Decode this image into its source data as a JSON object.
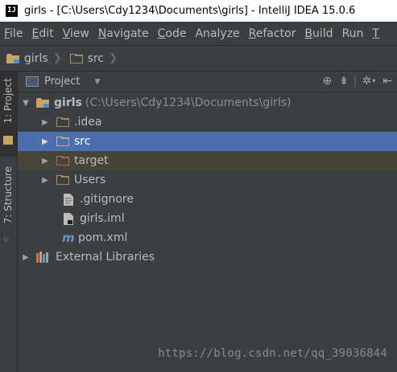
{
  "window": {
    "title": "girls - [C:\\Users\\Cdy1234\\Documents\\girls] - IntelliJ IDEA 15.0.6",
    "app_icon_text": "IJ"
  },
  "menu": [
    {
      "mnemonic": "F",
      "rest": "ile"
    },
    {
      "mnemonic": "E",
      "rest": "dit"
    },
    {
      "mnemonic": "V",
      "rest": "iew"
    },
    {
      "mnemonic": "N",
      "rest": "avigate"
    },
    {
      "mnemonic": "C",
      "rest": "ode"
    },
    {
      "mnemonic": "",
      "rest": "Analyze"
    },
    {
      "mnemonic": "R",
      "rest": "efactor"
    },
    {
      "mnemonic": "B",
      "rest": "uild"
    },
    {
      "mnemonic": "",
      "rest": "Run"
    },
    {
      "mnemonic": "T",
      "rest": ""
    }
  ],
  "breadcrumb": {
    "items": [
      "girls",
      "src"
    ]
  },
  "side_tabs": {
    "project": "1: Project",
    "structure": "7: Structure"
  },
  "panel": {
    "view_mode": "Project"
  },
  "tree": {
    "root": {
      "name": "girls",
      "path": "(C:\\Users\\Cdy1234\\Documents\\girls)"
    },
    "items": [
      {
        "name": ".idea"
      },
      {
        "name": "src"
      },
      {
        "name": "target"
      },
      {
        "name": "Users"
      },
      {
        "name": ".gitignore"
      },
      {
        "name": "girls.iml"
      },
      {
        "name": "pom.xml"
      }
    ],
    "external": "External Libraries"
  },
  "watermark": "https://blog.csdn.net/qq_39036844",
  "colors": {
    "background": "#3c3f41",
    "selection": "#4b6eaf",
    "excluded_row": "#49443a",
    "folder": "#c6a464",
    "source_folder": "#4a8fd6",
    "excluded_folder": "#d46b6b"
  }
}
